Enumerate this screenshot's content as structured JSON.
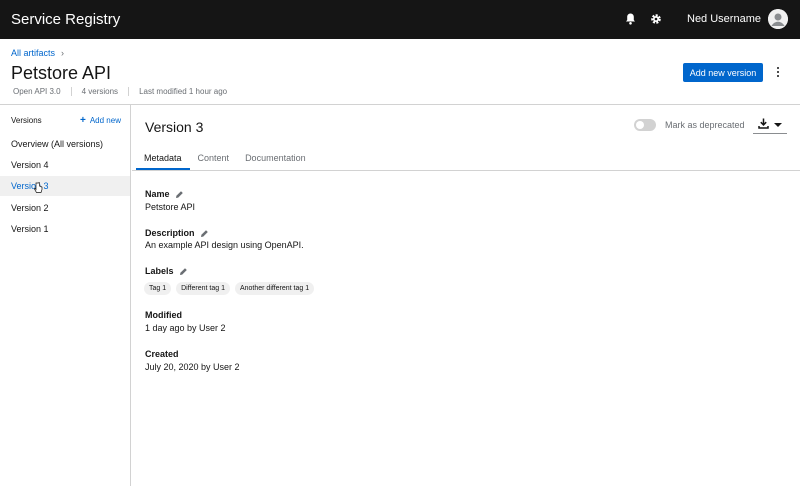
{
  "masthead": {
    "brand": "Service Registry",
    "username": "Ned Username",
    "icons": [
      "bell-icon",
      "gear-icon",
      "caret-down-icon",
      "avatar"
    ]
  },
  "page": {
    "breadcrumb": "All artifacts",
    "title": "Petstore API",
    "meta": [
      "Open API 3.0",
      "4 versions",
      "Last modified 1 hour ago"
    ],
    "add_version_label": "Add new version"
  },
  "sidebar": {
    "heading": "Versions",
    "add_label": "Add new",
    "items": [
      {
        "label": "Overview (All versions)"
      },
      {
        "label": "Version 4"
      },
      {
        "label": "Version 3",
        "active": true
      },
      {
        "label": "Version 2"
      },
      {
        "label": "Version 1"
      }
    ]
  },
  "main": {
    "title": "Version 3",
    "deprecate_label": "Mark as deprecated",
    "tabs": [
      {
        "label": "Metadata",
        "active": true
      },
      {
        "label": "Content"
      },
      {
        "label": "Documentation"
      }
    ],
    "fields": {
      "name": {
        "label": "Name",
        "value": "Petstore API"
      },
      "description": {
        "label": "Description",
        "value": "An example API design using OpenAPI."
      },
      "labels": {
        "label": "Labels",
        "tags": [
          "Tag 1",
          "Different tag 1",
          "Another different tag 1"
        ]
      },
      "modified": {
        "label": "Modified",
        "value": "1 day ago by User 2"
      },
      "created": {
        "label": "Created",
        "value": "July 20, 2020 by User 2"
      }
    }
  },
  "colors": {
    "masthead": "#151515",
    "accent": "#0066cc",
    "muted_text": "#6a6e73",
    "border": "#d2d2d2"
  }
}
